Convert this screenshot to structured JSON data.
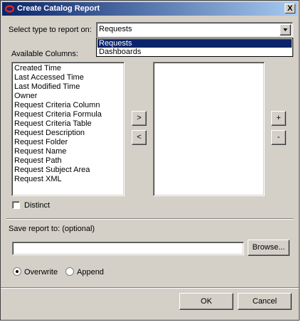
{
  "dialog": {
    "title": "Create Catalog Report",
    "close_label": "X"
  },
  "type_select": {
    "label": "Select type to report on:",
    "value": "Requests",
    "options": [
      "Requests",
      "Dashboards"
    ]
  },
  "available_columns": {
    "label": "Available Columns:",
    "items": [
      "Created Time",
      "Last Accessed Time",
      "Last Modified Time",
      "Owner",
      "Request Criteria Column",
      "Request Criteria Formula",
      "Request Criteria Table",
      "Request Description",
      "Request Folder",
      "Request Name",
      "Request Path",
      "Request Subject Area",
      "Request XML"
    ]
  },
  "move_buttons": {
    "add": ">",
    "remove": "<"
  },
  "order_buttons": {
    "up": "+",
    "down": "-"
  },
  "distinct": {
    "label": "Distinct",
    "checked": false
  },
  "save": {
    "label": "Save report to: (optional)",
    "value": "",
    "browse_label": "Browse..."
  },
  "write_mode": {
    "overwrite_label": "Overwrite",
    "append_label": "Append",
    "selected": "Overwrite"
  },
  "footer": {
    "ok_label": "OK",
    "cancel_label": "Cancel"
  }
}
